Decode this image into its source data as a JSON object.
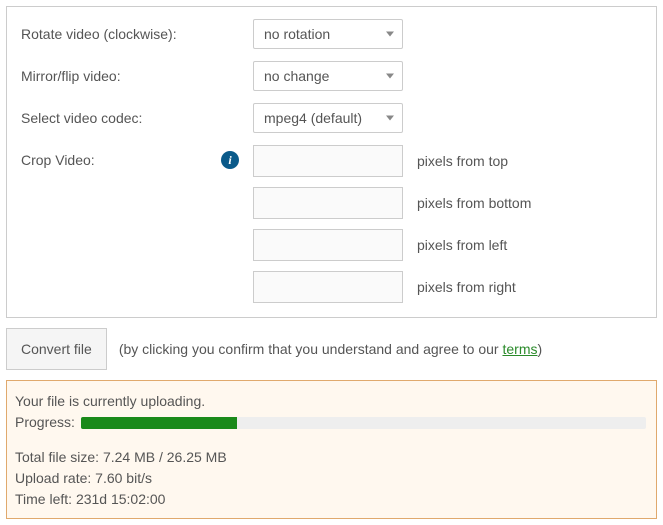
{
  "options": {
    "rotate": {
      "label": "Rotate video (clockwise):",
      "value": "no rotation"
    },
    "mirror": {
      "label": "Mirror/flip video:",
      "value": "no change"
    },
    "codec": {
      "label": "Select video codec:",
      "value": "mpeg4 (default)"
    },
    "crop": {
      "label": "Crop Video:",
      "top": {
        "value": "",
        "suffix": "pixels from top"
      },
      "bottom": {
        "value": "",
        "suffix": "pixels from bottom"
      },
      "left": {
        "value": "",
        "suffix": "pixels from left"
      },
      "right": {
        "value": "",
        "suffix": "pixels from right"
      }
    }
  },
  "convert": {
    "button": "Convert file",
    "confirm_pre": "(by clicking you confirm that you understand and agree to our ",
    "terms": "terms",
    "confirm_post": ")"
  },
  "upload": {
    "status": "Your file is currently uploading.",
    "progress_label": "Progress:",
    "progress_percent": 27.6,
    "total_label": "Total file size: ",
    "total_value": "7.24 MB / 26.25 MB",
    "rate_label": "Upload rate: ",
    "rate_value": "7.60 bit/s",
    "time_label": "Time left: ",
    "time_value": "231d 15:02:00"
  }
}
